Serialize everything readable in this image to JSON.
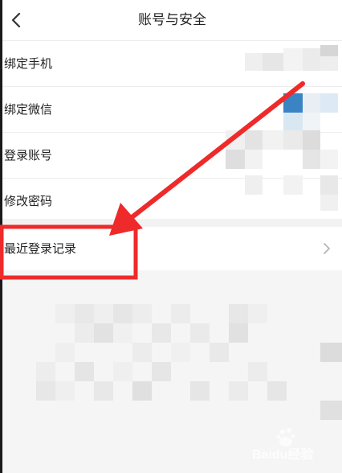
{
  "header": {
    "title": "账号与安全"
  },
  "settings": {
    "items": [
      {
        "label": "绑定手机"
      },
      {
        "label": "绑定微信"
      },
      {
        "label": "登录账号"
      },
      {
        "label": "修改密码"
      }
    ],
    "recent_login": {
      "label": "最近登录记录"
    }
  },
  "watermark": {
    "text": "Baidu经验"
  },
  "colors": {
    "annotation_red": "#ee2a2a",
    "wechat_blue": "#3a84c4"
  },
  "icons": {
    "back": "chevron-left-icon",
    "row_arrow": "chevron-right-icon"
  }
}
